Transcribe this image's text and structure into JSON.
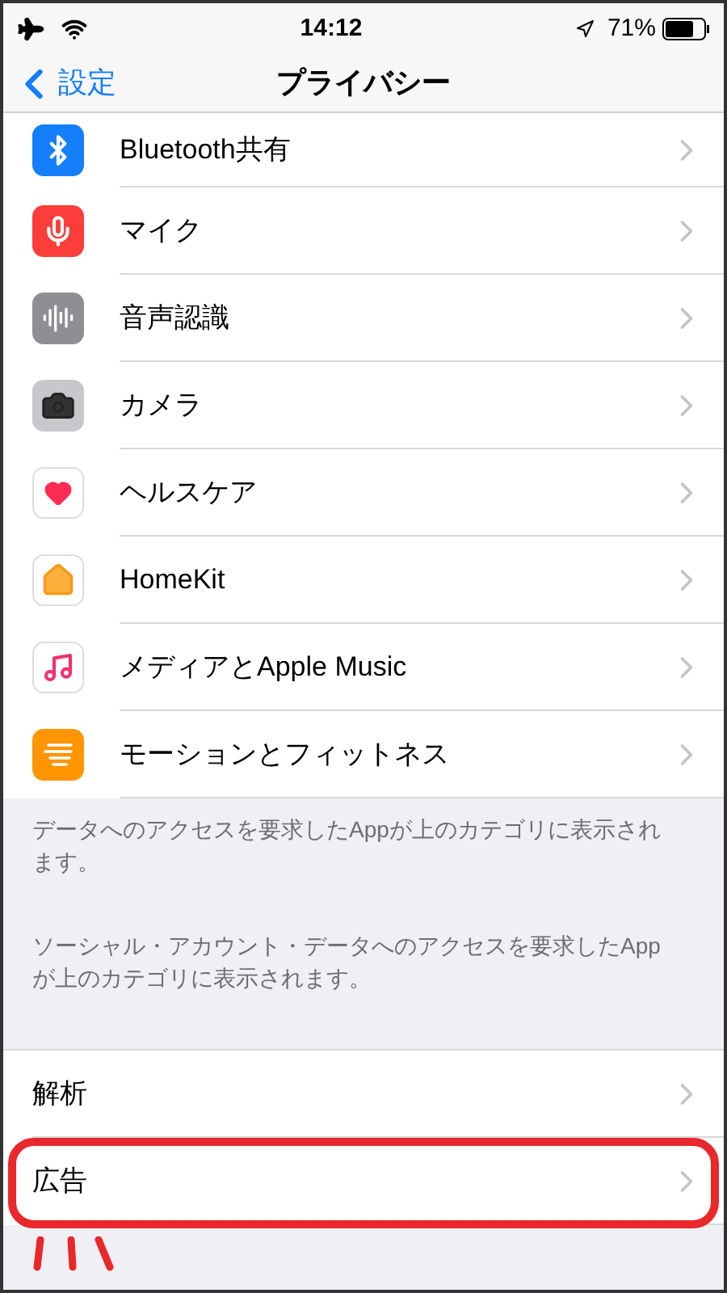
{
  "status_bar": {
    "time": "14:12",
    "battery": "71%"
  },
  "nav": {
    "back": "設定",
    "title": "プライバシー"
  },
  "privacy_items": [
    {
      "label": "Bluetooth共有",
      "kind": "bluetooth"
    },
    {
      "label": "マイク",
      "kind": "microphone"
    },
    {
      "label": "音声認識",
      "kind": "speech"
    },
    {
      "label": "カメラ",
      "kind": "camera"
    },
    {
      "label": "ヘルスケア",
      "kind": "health"
    },
    {
      "label": "HomeKit",
      "kind": "home"
    },
    {
      "label": "メディアとApple Music",
      "kind": "music"
    },
    {
      "label": "モーションとフィットネス",
      "kind": "motion"
    }
  ],
  "notes": [
    "データへのアクセスを要求したAppが上のカテゴリに表示されます。",
    "ソーシャル・アカウント・データへのアクセスを要求したAppが上のカテゴリに表示されます。"
  ],
  "other_items": [
    {
      "label": "解析",
      "highlighted": false
    },
    {
      "label": "広告",
      "highlighted": true
    }
  ]
}
